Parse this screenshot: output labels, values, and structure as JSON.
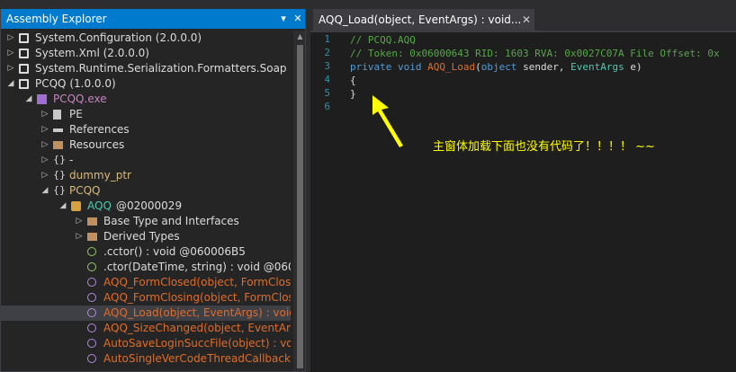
{
  "assembly_explorer": {
    "title": "Assembly Explorer",
    "header_controls": [
      "▾",
      "✕"
    ],
    "items": [
      {
        "label": "System.Configuration (2.0.0.0)",
        "color": "#dcdcdc",
        "icon": "assembly-icon",
        "expander": "▷"
      },
      {
        "label": "System.Xml (2.0.0.0)",
        "color": "#dcdcdc",
        "icon": "assembly-icon",
        "expander": "▷"
      },
      {
        "label": "System.Runtime.Serialization.Formatters.Soap (2.0",
        "color": "#dcdcdc",
        "icon": "assembly-icon",
        "expander": "▷"
      },
      {
        "label": "PCQQ (1.0.0.0)",
        "color": "#dcdcdc",
        "icon": "assembly-icon",
        "expander": "◢"
      },
      {
        "label": "PCQQ.exe",
        "color": "#c586c0",
        "icon": "module-icon",
        "expander": "◢"
      },
      {
        "label": "PE",
        "color": "#dcdcdc",
        "icon": "pe-icon",
        "expander": "▷"
      },
      {
        "label": "References",
        "color": "#dcdcdc",
        "icon": "references-icon",
        "expander": "▷"
      },
      {
        "label": "Resources",
        "color": "#dcdcdc",
        "icon": "folder-icon",
        "expander": "▷"
      },
      {
        "label": "-",
        "color": "#dcdcdc",
        "icon": "namespace-icon",
        "expander": "▷"
      },
      {
        "label": "dummy_ptr",
        "color": "#d7ba7d",
        "icon": "namespace-icon",
        "expander": "▷"
      },
      {
        "label": "PCQQ",
        "color": "#d7ba7d",
        "icon": "namespace-icon",
        "expander": "◢"
      },
      {
        "label": "AQQ",
        "suffix": "@02000029",
        "color": "#4ec9b0",
        "icon": "class-icon",
        "expander": "◢"
      },
      {
        "label": "Base Type and Interfaces",
        "color": "#dcdcdc",
        "icon": "folder-icon",
        "expander": "▷"
      },
      {
        "label": "Derived Types",
        "color": "#dcdcdc",
        "icon": "folder-icon",
        "expander": "▷"
      },
      {
        "label": ".cctor() : void @060006B5",
        "color": "#dcdcdc",
        "icon": "method-icon",
        "expander": ""
      },
      {
        "label": ".ctor(DateTime, string) : void @0600",
        "color": "#dcdcdc",
        "icon": "method-icon",
        "expander": ""
      },
      {
        "label": "AQQ_FormClosed(object, FormClose",
        "color": "#e06c2a",
        "icon": "method-private-icon",
        "expander": ""
      },
      {
        "label": "AQQ_FormClosing(object, FormClos",
        "color": "#e06c2a",
        "icon": "method-private-icon",
        "expander": ""
      },
      {
        "label": "AQQ_Load(object, EventArgs) : void",
        "color": "#e06c2a",
        "icon": "method-private-icon",
        "expander": "",
        "selected": true
      },
      {
        "label": "AQQ_SizeChanged(object, EventArg",
        "color": "#e06c2a",
        "icon": "method-private-icon",
        "expander": ""
      },
      {
        "label": "AutoSaveLoginSuccFile(object) : voi",
        "color": "#e06c2a",
        "icon": "method-private-icon",
        "expander": ""
      },
      {
        "label": "AutoSingleVerCodeThreadCallback(",
        "color": "#e06c2a",
        "icon": "method-private-icon",
        "expander": ""
      }
    ]
  },
  "editor": {
    "tab_title": "AQQ_Load(object, EventArgs) : void...",
    "tab_close": "✕",
    "line_numbers": [
      "1",
      "2",
      "3",
      "4",
      "5",
      "6"
    ],
    "lines": [
      "// PCQQ.AQQ",
      "// Token: 0x06000643 RID: 1603 RVA: 0x0027C07A File Offset: 0x",
      "private void AQQ_Load(object sender, EventArgs e)",
      "{",
      "}",
      ""
    ],
    "line3_tokens": {
      "kw1": "private",
      "kw2": "void",
      "method": "AQQ_Load",
      "p1_type": "object",
      "p1_name": "sender",
      "p2_type": "EventArgs",
      "p2_name": "e"
    },
    "annotation": "主窗体加载下面也没有代码了！！！！ ~~",
    "annotation_color": "#ffff00"
  }
}
